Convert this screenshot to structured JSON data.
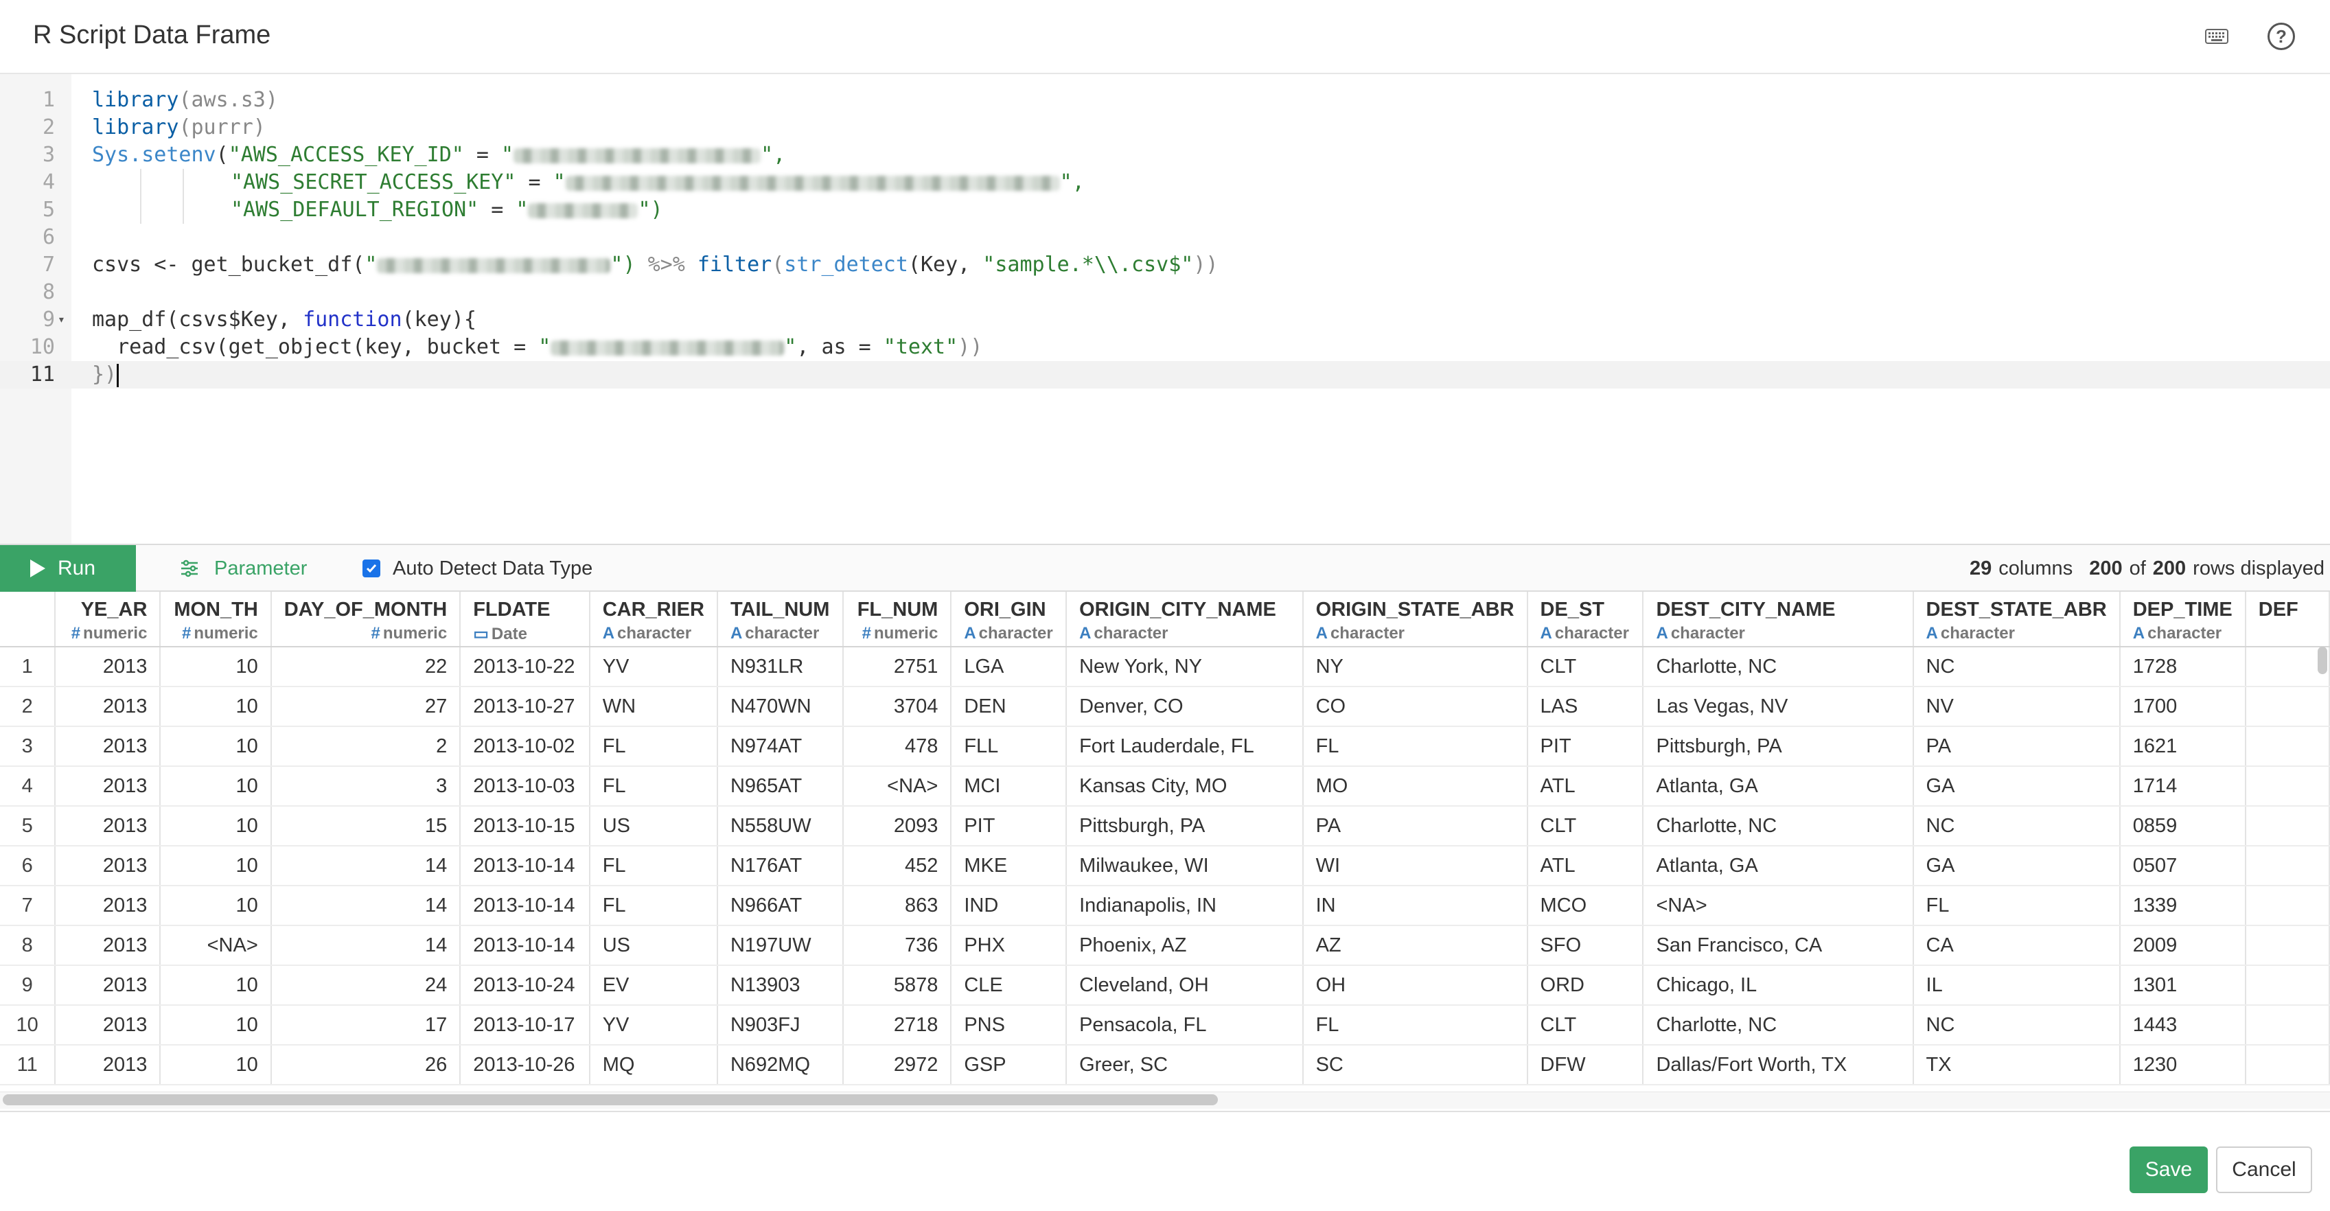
{
  "dialog": {
    "title": "R Script Data Frame"
  },
  "header": {
    "keyboard_icon": "keyboard-icon",
    "help_icon": "help-icon",
    "help_glyph": "?"
  },
  "editor": {
    "line_numbers": [
      "1",
      "2",
      "3",
      "4",
      "5",
      "6",
      "7",
      "8",
      "9",
      "10",
      "11"
    ],
    "code": {
      "l1_fn": "library",
      "l1_rest": "(aws.s3)",
      "l2_fn": "library",
      "l2_rest": "(purrr)",
      "l3_fn": "Sys.setenv",
      "l3_open": "(",
      "l3_str": "\"AWS_ACCESS_KEY_ID\"",
      "l3_eq": " = ",
      "l3_q1": "\"",
      "l3_q2": "\",",
      "l4_str": "\"AWS_SECRET_ACCESS_KEY\"",
      "l4_eq": " = ",
      "l4_q1": "\"",
      "l4_q2": "\",",
      "l5_str": "\"AWS_DEFAULT_REGION\"",
      "l5_eq": " = ",
      "l5_q1": "\"",
      "l5_q2": "\")",
      "l7_a": "csvs <- get_bucket_df(",
      "l7_q1": "\"",
      "l7_q2": "\")",
      "l7_pipe": " %>% ",
      "l7_filter": "filter",
      "l7_b": "(",
      "l7_detect": "str_detect",
      "l7_c": "(Key, ",
      "l7_str": "\"sample.*\\\\.csv$\"",
      "l7_d": "))",
      "l9_a": "map_df",
      "l9_b": "(csvs$Key, ",
      "l9_kw": "function",
      "l9_c": "(key){",
      "l10_a": "  read_csv(get_object(key, bucket = ",
      "l10_q1": "\"",
      "l10_q2": "\"",
      "l10_b": ", as = ",
      "l10_str": "\"text\"",
      "l10_c": "))",
      "l11": "})"
    }
  },
  "toolbar": {
    "run_label": "Run",
    "parameter_label": "Parameter",
    "auto_detect_label": "Auto Detect Data Type",
    "auto_detect_checked": true,
    "columns_count": "29",
    "columns_label": "columns",
    "rows_shown": "200",
    "rows_of": "of",
    "rows_total": "200",
    "rows_label": "rows displayed"
  },
  "grid": {
    "columns": [
      {
        "name": "YE_AR",
        "type": "numeric",
        "type_icon": "#"
      },
      {
        "name": "MON_TH",
        "type": "numeric",
        "type_icon": "#"
      },
      {
        "name": "DAY_OF_MONTH",
        "type": "numeric",
        "type_icon": "#"
      },
      {
        "name": "FLDATE",
        "type": "Date",
        "type_icon": "calendar"
      },
      {
        "name": "CAR_RIER",
        "type": "character",
        "type_icon": "A"
      },
      {
        "name": "TAIL_NUM",
        "type": "character",
        "type_icon": "A"
      },
      {
        "name": "FL_NUM",
        "type": "numeric",
        "type_icon": "#"
      },
      {
        "name": "ORI_GIN",
        "type": "character",
        "type_icon": "A"
      },
      {
        "name": "ORIGIN_CITY_NAME",
        "type": "character",
        "type_icon": "A"
      },
      {
        "name": "ORIGIN_STATE_ABR",
        "type": "character",
        "type_icon": "A"
      },
      {
        "name": "DE_ST",
        "type": "character",
        "type_icon": "A"
      },
      {
        "name": "DEST_CITY_NAME",
        "type": "character",
        "type_icon": "A"
      },
      {
        "name": "DEST_STATE_ABR",
        "type": "character",
        "type_icon": "A"
      },
      {
        "name": "DEP_TIME",
        "type": "character",
        "type_icon": "A"
      },
      {
        "name": "DEF",
        "type": "",
        "type_icon": ""
      }
    ],
    "rows": [
      [
        "1",
        "2013",
        "10",
        "22",
        "2013-10-22",
        "YV",
        "N931LR",
        "2751",
        "LGA",
        "New York, NY",
        "NY",
        "CLT",
        "Charlotte, NC",
        "NC",
        "1728",
        ""
      ],
      [
        "2",
        "2013",
        "10",
        "27",
        "2013-10-27",
        "WN",
        "N470WN",
        "3704",
        "DEN",
        "Denver, CO",
        "CO",
        "LAS",
        "Las Vegas, NV",
        "NV",
        "1700",
        ""
      ],
      [
        "3",
        "2013",
        "10",
        "2",
        "2013-10-02",
        "FL",
        "N974AT",
        "478",
        "FLL",
        "Fort Lauderdale, FL",
        "FL",
        "PIT",
        "Pittsburgh, PA",
        "PA",
        "1621",
        ""
      ],
      [
        "4",
        "2013",
        "10",
        "3",
        "2013-10-03",
        "FL",
        "N965AT",
        "<NA>",
        "MCI",
        "Kansas City, MO",
        "MO",
        "ATL",
        "Atlanta, GA",
        "GA",
        "1714",
        ""
      ],
      [
        "5",
        "2013",
        "10",
        "15",
        "2013-10-15",
        "US",
        "N558UW",
        "2093",
        "PIT",
        "Pittsburgh, PA",
        "PA",
        "CLT",
        "Charlotte, NC",
        "NC",
        "0859",
        ""
      ],
      [
        "6",
        "2013",
        "10",
        "14",
        "2013-10-14",
        "FL",
        "N176AT",
        "452",
        "MKE",
        "Milwaukee, WI",
        "WI",
        "ATL",
        "Atlanta, GA",
        "GA",
        "0507",
        ""
      ],
      [
        "7",
        "2013",
        "10",
        "14",
        "2013-10-14",
        "FL",
        "N966AT",
        "863",
        "IND",
        "Indianapolis, IN",
        "IN",
        "MCO",
        "<NA>",
        "FL",
        "1339",
        ""
      ],
      [
        "8",
        "2013",
        "<NA>",
        "14",
        "2013-10-14",
        "US",
        "N197UW",
        "736",
        "PHX",
        "Phoenix, AZ",
        "AZ",
        "SFO",
        "San Francisco, CA",
        "CA",
        "2009",
        ""
      ],
      [
        "9",
        "2013",
        "10",
        "24",
        "2013-10-24",
        "EV",
        "N13903",
        "5878",
        "CLE",
        "Cleveland, OH",
        "OH",
        "ORD",
        "Chicago, IL",
        "IL",
        "1301",
        ""
      ],
      [
        "10",
        "2013",
        "10",
        "17",
        "2013-10-17",
        "YV",
        "N903FJ",
        "2718",
        "PNS",
        "Pensacola, FL",
        "FL",
        "CLT",
        "Charlotte, NC",
        "NC",
        "1443",
        ""
      ],
      [
        "11",
        "2013",
        "10",
        "26",
        "2013-10-26",
        "MQ",
        "N692MQ",
        "2972",
        "GSP",
        "Greer, SC",
        "SC",
        "DFW",
        "Dallas/Fort Worth, TX",
        "TX",
        "1230",
        ""
      ]
    ]
  },
  "footer": {
    "save_label": "Save",
    "cancel_label": "Cancel"
  },
  "colors": {
    "accent": "#3aa366",
    "checkbox": "#1a73e8",
    "type_icon": "#3c7fc0"
  }
}
